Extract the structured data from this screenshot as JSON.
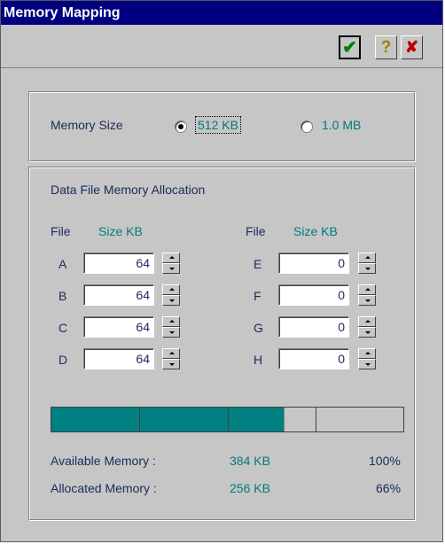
{
  "window": {
    "title": "Memory Mapping"
  },
  "toolbar": {
    "ok_icon": "checkmark-icon",
    "help_icon": "question-mark-icon",
    "cancel_icon": "red-x-icon",
    "ok_glyph": "✔",
    "help_glyph": "?",
    "cancel_glyph": "✘"
  },
  "memory_size": {
    "label": "Memory Size",
    "options": [
      {
        "label": "512 KB",
        "selected": true
      },
      {
        "label": "1.0 MB",
        "selected": false
      }
    ]
  },
  "allocation": {
    "title": "Data File Memory  Allocation",
    "col_file": "File",
    "col_size": "Size KB",
    "files": [
      {
        "name": "A",
        "size": "64"
      },
      {
        "name": "B",
        "size": "64"
      },
      {
        "name": "C",
        "size": "64"
      },
      {
        "name": "D",
        "size": "64"
      },
      {
        "name": "E",
        "size": "0"
      },
      {
        "name": "F",
        "size": "0"
      },
      {
        "name": "G",
        "size": "0"
      },
      {
        "name": "H",
        "size": "0"
      }
    ]
  },
  "usage": {
    "allocated_fraction": 0.66,
    "segments": 4,
    "available_label": "Available Memory :",
    "available_value": "384 KB",
    "available_pct": "100%",
    "allocated_label": "Allocated Memory :",
    "allocated_value": "256 KB",
    "allocated_pct": "66%"
  },
  "colors": {
    "title_bar": "#000080",
    "accent_teal": "#008080",
    "window_bg": "#c6c6c6"
  }
}
